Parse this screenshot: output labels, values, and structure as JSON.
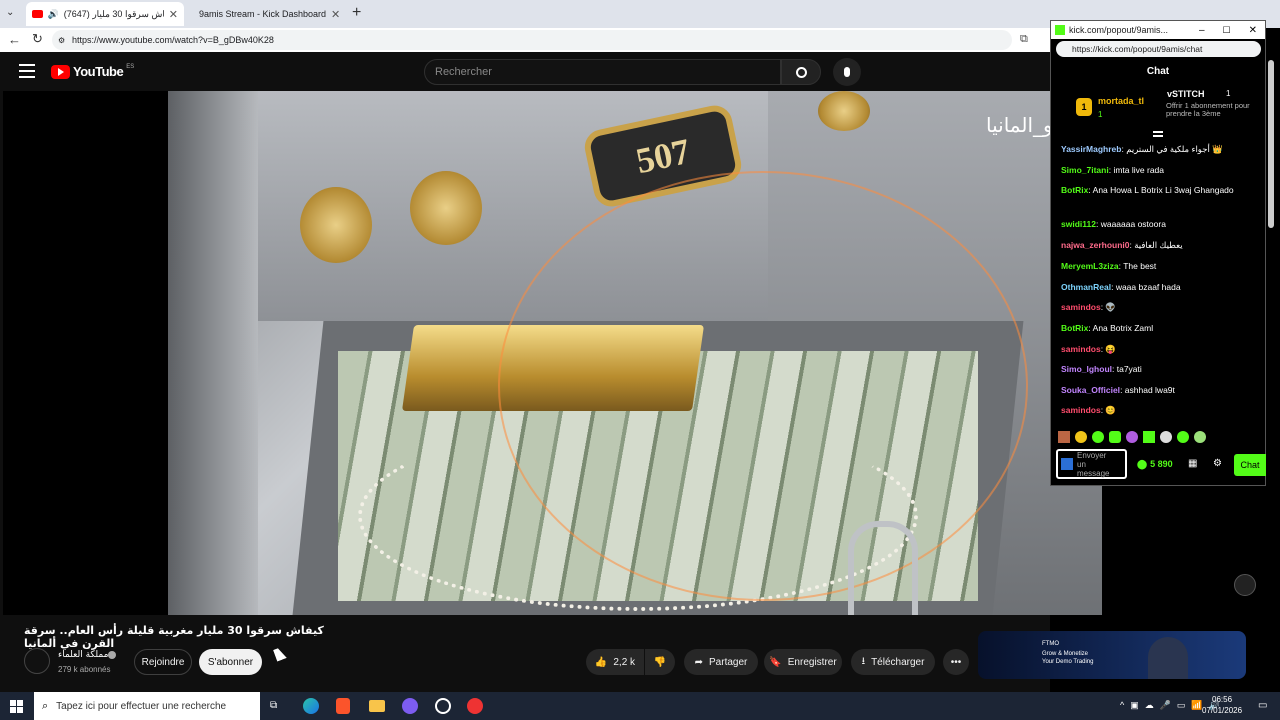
{
  "browser": {
    "tabs": [
      {
        "label": "(7647) كيفاش سرقوا 30 مليار ...",
        "active": true
      },
      {
        "label": "9amis Stream - Kick Dashboard",
        "active": false
      }
    ],
    "new_tab": "+",
    "url": "https://www.youtube.com/watch?v=B_gDBw40K28"
  },
  "youtube": {
    "logo": "YouTube",
    "region": "ES",
    "search_placeholder": "Rechercher",
    "video_overlay_text": "و_المانيا",
    "video_number": "507",
    "title": "كيفاش سرقوا 30 مليار مغربية قليلة رأس العام.. سرقة القرن في ألمانيا",
    "channel": {
      "name": "مملكة العلماء",
      "subscribers": "279 k abonnés"
    },
    "join_label": "Rejoindre",
    "subscribe_label": "S'abonner",
    "likes": "2,2 k",
    "share_label": "Partager",
    "save_label": "Enregistrer",
    "download_label": "Télécharger",
    "ad": {
      "brand": "FTMO",
      "line1": "Grow & Monetize",
      "line2": "Your Demo Trading"
    }
  },
  "kick": {
    "title": "kick.com/popout/9amis...",
    "url": "https://kick.com/popout/9amis/chat",
    "header": "Chat",
    "pinned": {
      "rank": "1",
      "user": "mortada_tl",
      "count": "1",
      "gifter": "vSTITCH",
      "gifter_count": "1",
      "gift_text": "Offrir 1 abonnement pour prendre la 3ème"
    },
    "messages": [
      {
        "user": "YassirMaghreb",
        "text": "أجواء ملكية في الستريم 👑",
        "color": "#9ecbff"
      },
      {
        "user": "Simo_7itani",
        "text": "imta live rada",
        "color": "#53fc18"
      },
      {
        "user": "BotRix",
        "text": "Ana Howa L Botrix Li 3waj Ghangado",
        "color": "#53fc18"
      },
      {
        "user": "swidi112",
        "text": "waaaaaa ostoora",
        "color": "#53fc18"
      },
      {
        "user": "najwa_zerhouni0",
        "text": "يعطيك العافية",
        "color": "#ff6b8b"
      },
      {
        "user": "MeryemL3ziza",
        "text": "The best",
        "color": "#53fc18"
      },
      {
        "user": "OthmanReal",
        "text": "waaa bzaaf hada",
        "color": "#7dd3fc"
      },
      {
        "user": "samindos",
        "text": "👽",
        "color": "#ff4d6d"
      },
      {
        "user": "BotRix",
        "text": "Ana Botrix Zaml",
        "color": "#53fc18"
      },
      {
        "user": "samindos",
        "text": "😝",
        "color": "#ff4d6d"
      },
      {
        "user": "Simo_lghoul",
        "text": "ta7yati",
        "color": "#c084fc"
      },
      {
        "user": "Souka_Officiel",
        "text": "ashhad lwa9t",
        "color": "#c084fc"
      },
      {
        "user": "samindos",
        "text": "😊",
        "color": "#ff4d6d"
      }
    ],
    "input_placeholder": "Envoyer un message",
    "points": "5 890",
    "chat_button": "Chat"
  },
  "taskbar": {
    "search_placeholder": "Tapez ici pour effectuer une recherche",
    "time": "06:56",
    "date": "07/01/2026"
  },
  "colors": {
    "kick_green": "#53fc18",
    "yt_red": "#ff0000"
  }
}
